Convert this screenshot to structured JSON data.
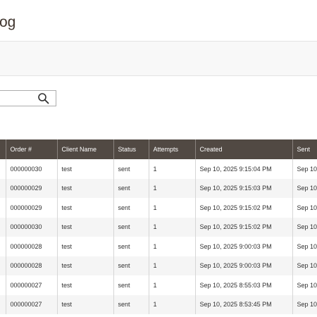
{
  "page": {
    "title": "og"
  },
  "search": {
    "placeholder": ""
  },
  "grid": {
    "columns": [
      "",
      "Order #",
      "Client Name",
      "Status",
      "Attempts",
      "Created",
      "Sent"
    ],
    "rows": [
      [
        "",
        "000000030",
        "test",
        "sent",
        "1",
        "Sep 10, 2025 9:15:04 PM",
        "Sep 10"
      ],
      [
        "",
        "000000029",
        "test",
        "sent",
        "1",
        "Sep 10, 2025 9:15:03 PM",
        "Sep 10"
      ],
      [
        "",
        "000000029",
        "test",
        "sent",
        "1",
        "Sep 10, 2025 9:15:02 PM",
        "Sep 10"
      ],
      [
        "",
        "000000030",
        "test",
        "sent",
        "1",
        "Sep 10, 2025 9:15:02 PM",
        "Sep 10"
      ],
      [
        "",
        "000000028",
        "test",
        "sent",
        "1",
        "Sep 10, 2025 9:00:03 PM",
        "Sep 10"
      ],
      [
        "",
        "000000028",
        "test",
        "sent",
        "1",
        "Sep 10, 2025 9:00:03 PM",
        "Sep 10"
      ],
      [
        "",
        "000000027",
        "test",
        "sent",
        "1",
        "Sep 10, 2025 8:55:03 PM",
        "Sep 10"
      ],
      [
        "",
        "000000027",
        "test",
        "sent",
        "1",
        "Sep 10, 2025 8:53:45 PM",
        "Sep 10"
      ]
    ]
  },
  "icons": {
    "search": "magnifier-icon"
  }
}
